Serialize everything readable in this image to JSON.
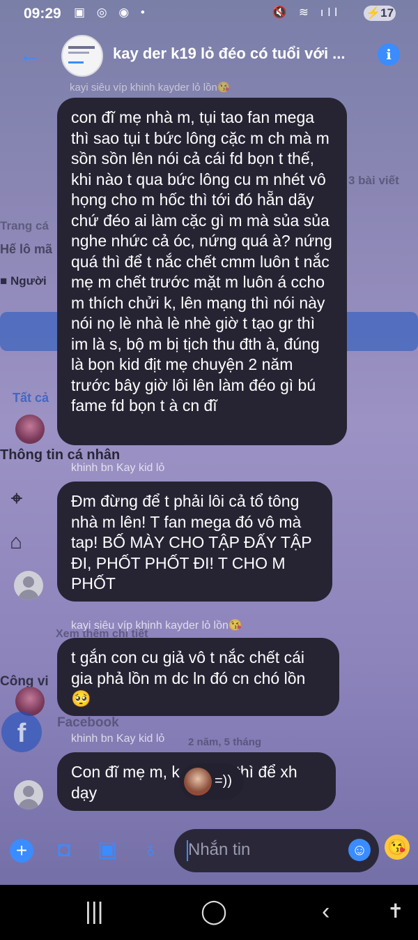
{
  "status": {
    "time": "09:29",
    "battery": "17"
  },
  "header": {
    "title": "kay der k19 lỏ đéo có tuổi với ..."
  },
  "background_profile": {
    "posts": "3 bài viết",
    "trang_ca": "Trang cá",
    "he_lo_ma": "Hế lô mã",
    "nguoi": "Người",
    "tat_ca": "Tất cả",
    "thong_tin": "Thông tin cá nhân",
    "xem_them": "Xem thêm chi tiết",
    "cong_vi": "Công vi",
    "facebook": "Facebook",
    "duration": "2 năm, 5 tháng",
    "top_sender": "kayi siêu víp khinh kayder lỏ lồn😘"
  },
  "messages": [
    {
      "sender": "",
      "text": "con đĩ mẹ nhà m, tụi tao fan mega thì sao tụi t bức lông cặc m ch mà m sồn sồn lên nói cả cái fd bọn t thế, khi nào t qua bức lông cu m nhét vô họng cho m hốc thì tới đó hẵn dãy chứ đéo ai làm cặc gì m mà sủa sủa nghe nhức cả óc, nứng quá à? nứng quá thì để t nắc chết cmm luôn t nắc mẹ m chết trước mặt m luôn á ccho m thích chửi k, lên mạng thì nói này nói nọ lè nhà lè nhè giờ t tạo gr thì im là s, bộ m bị tịch thu đth à, đúng là bọn kid địt mẹ chuyện 2 năm trước bây giờ lôi lên làm đéo gì bú fame fd bọn t à cn đĩ"
    },
    {
      "sender": "khinh bn Kay kid lỏ",
      "text": "Đm đừng để t phải lôi cả tổ tông nhà m lên! T fan mega đó vô mà tap! BỐ MÀY CHO TẬP ĐẤY TẬP ĐI, PHỐT PHỐT ĐI! T CHO M PHỐT"
    },
    {
      "sender": "kayi siêu víp khinh kayder lỏ lồn😘",
      "text": "t gắn con cu giả vô t nắc chết cái gia phả lồn m dc ln đó cn chó lồn 🥺"
    },
    {
      "sender": "khinh bn Kay kid lỏ",
      "text": "Con đĩ mẹ m, k dạy đc thì để xh dạy"
    }
  ],
  "reaction": {
    "text": "=))"
  },
  "composer": {
    "placeholder": "Nhắn tin"
  },
  "colors": {
    "accent": "#3a8cff",
    "bubble": "#262433"
  }
}
